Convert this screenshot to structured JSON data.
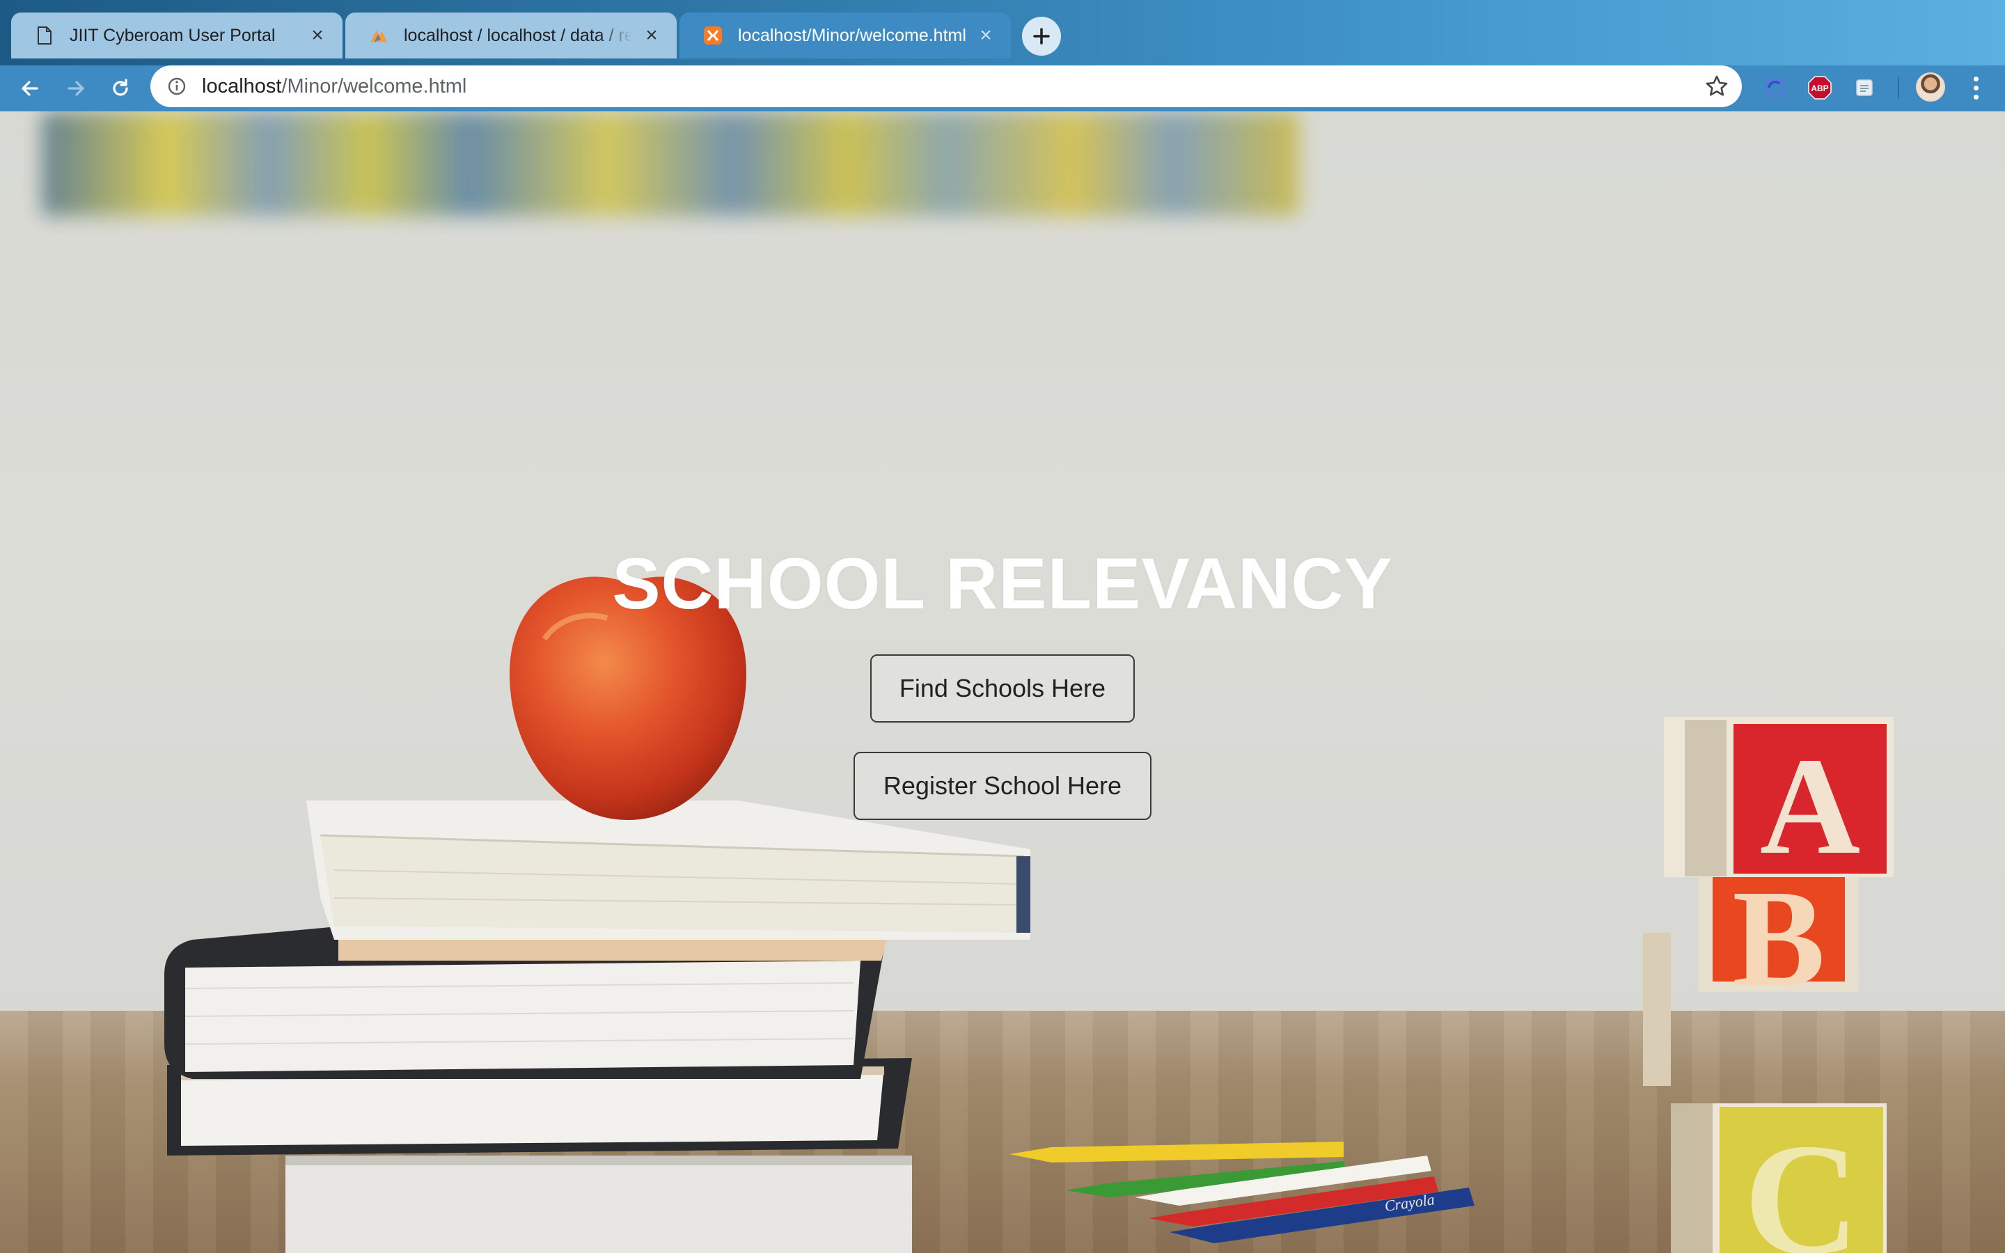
{
  "browser": {
    "tabs": [
      {
        "title": "JIIT Cyberoam User Portal",
        "favicon": "document-icon",
        "active": false
      },
      {
        "title": "localhost / localhost / data / re",
        "favicon": "phpmyadmin-icon",
        "active": false
      },
      {
        "title": "localhost/Minor/welcome.html",
        "favicon": "xampp-icon",
        "active": true
      }
    ],
    "close_glyph": "×",
    "address": {
      "host": "localhost",
      "path": "/Minor/welcome.html"
    },
    "colors": {
      "tabstrip": "#2e76a6",
      "active_tab": "#3e8bc4",
      "inactive_tab": "#9fc6e2"
    }
  },
  "page": {
    "hero_title": "SCHOOL RELEVANCY",
    "buttons": {
      "find": "Find Schools Here",
      "register": "Register School Here"
    },
    "blocks": [
      "A",
      "B",
      "C"
    ],
    "pencil_brand": "Crayola"
  }
}
